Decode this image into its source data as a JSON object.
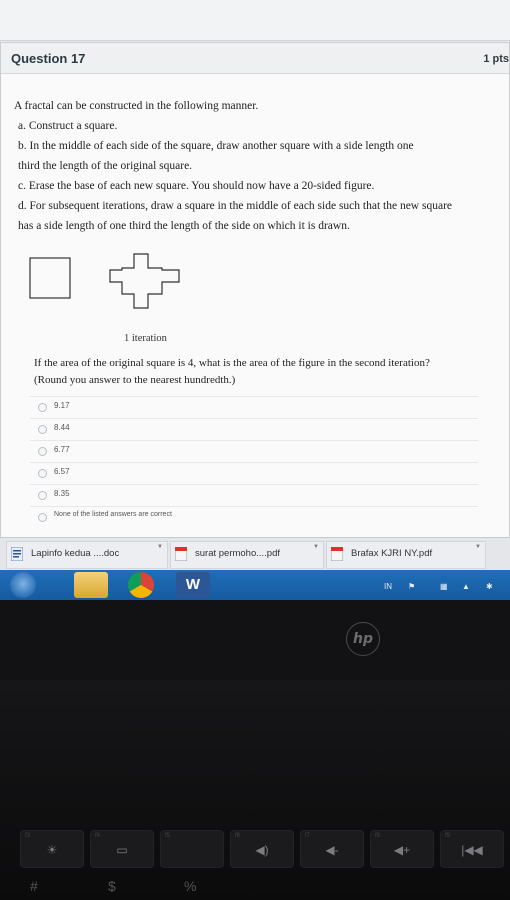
{
  "question": {
    "title": "Question 17",
    "points": "1 pts",
    "lines": [
      "A fractal can be constructed in the following manner.",
      "a. Construct a square.",
      "b. In the middle of each side of the square, draw another square with a side length one",
      "third the length of the original square.",
      "c. Erase the base of each new square. You should now have a 20-sided figure.",
      "d. For subsequent iterations, draw a square in the middle of each side such that the new square",
      "has a side length of one third the length of the side on which it is drawn."
    ],
    "figure_caption": "1 iteration",
    "prompt_line1": "If the area of the original square is 4, what is the area of the figure in the second iteration?",
    "prompt_line2": "(Round you answer to the nearest hundredth.)",
    "answers": [
      "9.17",
      "8.44",
      "6.77",
      "6.57",
      "8.35",
      "None of the listed answers are correct"
    ]
  },
  "downloads": [
    {
      "name": "Lapinfo kedua ....doc",
      "icon": "doc-file-icon"
    },
    {
      "name": "surat permoho....pdf",
      "icon": "pdf-file-icon"
    },
    {
      "name": "Brafax KJRI NY.pdf",
      "icon": "pdf-file-icon"
    }
  ],
  "taskbar": {
    "apps": [
      "start-icon",
      "file-explorer-icon",
      "chrome-icon",
      "word-icon"
    ],
    "lang": "IN"
  },
  "laptop": {
    "brand": "hp",
    "fkeys": [
      "f3",
      "f4",
      "f5",
      "f6",
      "f7",
      "f8",
      "f9"
    ],
    "key_glyphs": [
      "☀",
      "▭",
      "",
      "◀)",
      "◀-",
      "◀+",
      "|◀◀"
    ],
    "symbols": [
      "#",
      "$",
      "%"
    ]
  },
  "colors": {
    "taskbar": "#1b63ad",
    "panel": "#fafafa",
    "text": "#222222"
  }
}
